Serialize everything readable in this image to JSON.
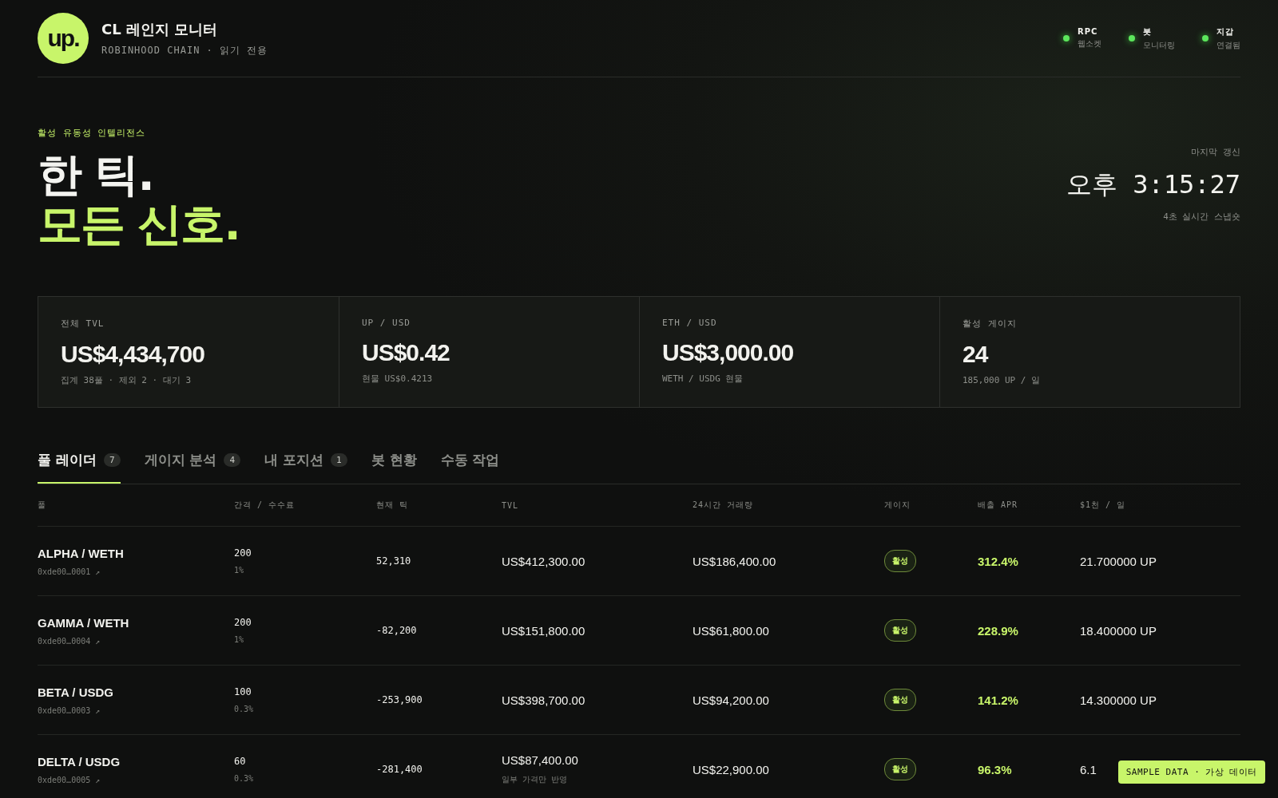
{
  "brand": {
    "logo": "up.",
    "title": "CL 레인지 모니터",
    "subtitle": "ROBINHOOD CHAIN · 읽기 전용"
  },
  "status": [
    {
      "label": "RPC",
      "detail": "웹소켓",
      "on": true
    },
    {
      "label": "봇",
      "detail": "모니터링",
      "on": true
    },
    {
      "label": "지갑",
      "detail": "연결됨",
      "on": true
    }
  ],
  "hero": {
    "eyebrow": "활성 유동성 인텔리전스",
    "line1": "한 틱.",
    "line2": "모든 신호."
  },
  "clock": {
    "label": "마지막 갱신",
    "time": "오후 3:15:27",
    "note": "4초 실시간 스냅숏"
  },
  "stats": [
    {
      "label": "전체 TVL",
      "value": "US$4,434,700",
      "note": "집계 38풀 · 제외 2 · 대기 3"
    },
    {
      "label": "UP / USD",
      "value": "US$0.42",
      "note": "현물 US$0.4213"
    },
    {
      "label": "ETH / USD",
      "value": "US$3,000.00",
      "note": "WETH / USDG 현물"
    },
    {
      "label": "활성 게이지",
      "value": "24",
      "note": "185,000 UP / 일"
    }
  ],
  "tabs": [
    {
      "label": "풀 레이더",
      "count": "7",
      "selected": true
    },
    {
      "label": "게이지 분석",
      "count": "4",
      "selected": false
    },
    {
      "label": "내 포지션",
      "count": "1",
      "selected": false
    },
    {
      "label": "봇 현황",
      "selected": false
    },
    {
      "label": "수동 작업",
      "selected": false
    }
  ],
  "table": {
    "columns": [
      "풀",
      "간격 / 수수료",
      "현재 틱",
      "TVL",
      "24시간 거래량",
      "게이지",
      "배출 APR",
      "$1천 / 일"
    ],
    "rows": [
      {
        "pool": "ALPHA / WETH",
        "address": "0xde00…0001 ↗",
        "spacing": "200",
        "fee": "1%",
        "tick": "52,310",
        "tvl": "US$412,300.00",
        "volume": "US$186,400.00",
        "gauge": "활성",
        "apr": "312.4%",
        "per_1k": "21.700000 UP"
      },
      {
        "pool": "GAMMA / WETH",
        "address": "0xde00…0004 ↗",
        "spacing": "200",
        "fee": "1%",
        "tick": "-82,200",
        "tvl": "US$151,800.00",
        "volume": "US$61,800.00",
        "gauge": "활성",
        "apr": "228.9%",
        "per_1k": "18.400000 UP"
      },
      {
        "pool": "BETA / USDG",
        "address": "0xde00…0003 ↗",
        "spacing": "100",
        "fee": "0.3%",
        "tick": "-253,900",
        "tvl": "US$398,700.00",
        "volume": "US$94,200.00",
        "gauge": "활성",
        "apr": "141.2%",
        "per_1k": "14.300000 UP"
      },
      {
        "pool": "DELTA / USDG",
        "address": "0xde00…0005 ↗",
        "spacing": "60",
        "fee": "0.3%",
        "tick": "-281,400",
        "tvl": "US$87,400.00",
        "tvl_note": "일부 가격만 반영",
        "volume": "US$22,900.00",
        "gauge": "활성",
        "apr": "96.3%",
        "per_1k": "6.1"
      }
    ]
  },
  "badge": "SAMPLE DATA · 가상 데이터"
}
